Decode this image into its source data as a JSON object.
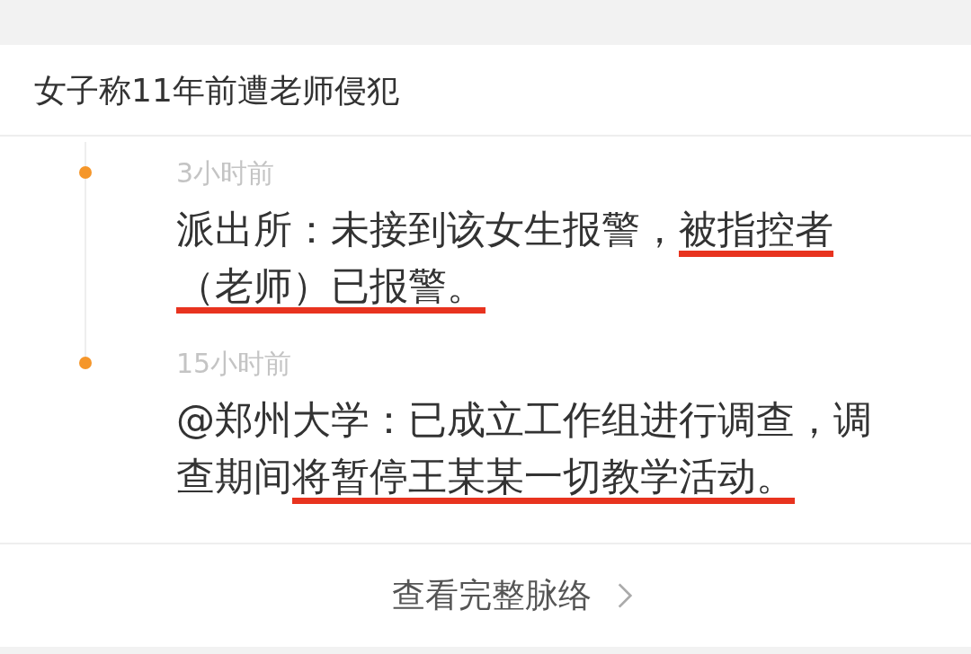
{
  "topic": {
    "title": "女子称11年前遭老师侵犯"
  },
  "timeline": [
    {
      "time": "3小时前",
      "segments": [
        {
          "text": "派出所：未接到该女生报警，",
          "underlined": false
        },
        {
          "text": "被指控者（老师）已报警。",
          "underlined": true
        }
      ]
    },
    {
      "time": "15小时前",
      "segments": [
        {
          "text": "@郑州大学：已成立工作组进行调查，调查期间",
          "underlined": false
        },
        {
          "text": "将暂停王某某一切教学活动。",
          "underlined": true
        }
      ]
    }
  ],
  "footer": {
    "link": "查看完整脉络"
  }
}
